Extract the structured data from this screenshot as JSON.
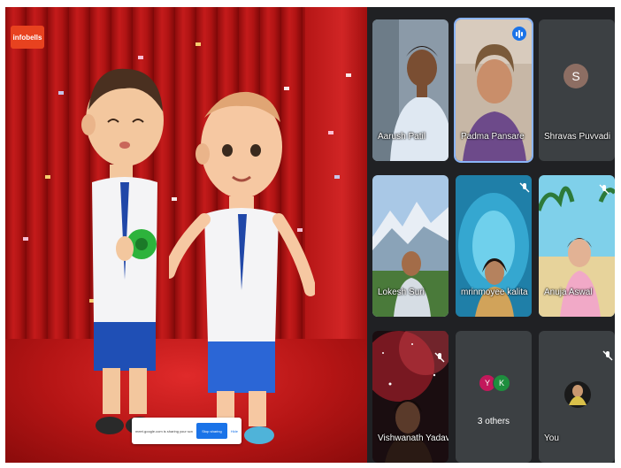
{
  "presentation": {
    "logo_text": "infobells",
    "share_bar": {
      "message": "meet.google.com is sharing your screen.",
      "stop_label": "Stop sharing",
      "hide_label": "Hide"
    }
  },
  "participants": [
    {
      "name": "Aarush Patil"
    },
    {
      "name": "Padma Pansare"
    },
    {
      "name": "Shravas Puvvadi",
      "initial": "S"
    },
    {
      "name": "Lokesh Suri"
    },
    {
      "name": "mrinmoyee kalita"
    },
    {
      "name": "Anuja Aswal"
    },
    {
      "name": "Vishwanath Yadav"
    },
    {
      "name": "3 others",
      "initials": [
        "Y",
        "K"
      ]
    },
    {
      "name": "You"
    }
  ],
  "colors": {
    "active_outline": "#8ab4f8",
    "tile_bg": "#3c4043",
    "others_y": "#c2185b",
    "others_k": "#1e8e3e",
    "avatar_s": "#8d6e63"
  }
}
